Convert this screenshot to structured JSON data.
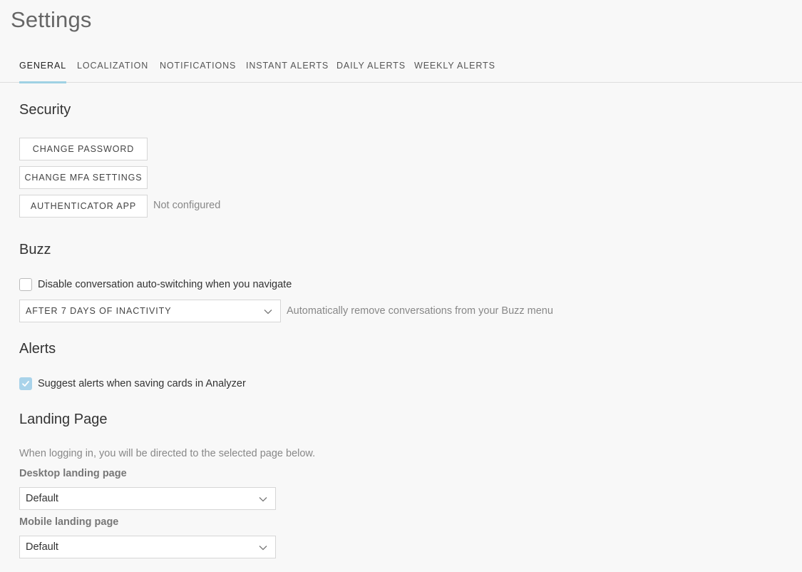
{
  "page": {
    "title": "Settings"
  },
  "tabs": [
    {
      "label": "GENERAL",
      "active": true
    },
    {
      "label": "LOCALIZATION",
      "active": false
    },
    {
      "label": "NOTIFICATIONS",
      "active": false
    },
    {
      "label": "INSTANT ALERTS",
      "active": false
    },
    {
      "label": "DAILY ALERTS",
      "active": false
    },
    {
      "label": "WEEKLY ALERTS",
      "active": false
    }
  ],
  "security": {
    "title": "Security",
    "change_password_label": "CHANGE PASSWORD",
    "change_mfa_label": "CHANGE MFA SETTINGS",
    "authenticator_label": "AUTHENTICATOR APP",
    "authenticator_status": "Not configured"
  },
  "buzz": {
    "title": "Buzz",
    "disable_autoswitch_label": "Disable conversation auto-switching when you navigate",
    "disable_autoswitch_checked": false,
    "removal_select_value": "AFTER 7 DAYS OF INACTIVITY",
    "removal_description": "Automatically remove conversations from your Buzz menu"
  },
  "alerts": {
    "title": "Alerts",
    "suggest_alerts_label": "Suggest alerts when saving cards in Analyzer",
    "suggest_alerts_checked": true
  },
  "landing": {
    "title": "Landing Page",
    "description": "When logging in, you will be directed to the selected page below.",
    "desktop_label": "Desktop landing page",
    "desktop_value": "Default",
    "mobile_label": "Mobile landing page",
    "mobile_value": "Default"
  },
  "colors": {
    "accent": "#9fd2e4",
    "checkbox_checked": "#a9d3ea",
    "background": "#f8f8f8"
  },
  "icons": {
    "checkmark": "check-icon",
    "dropdown": "chevron-down-icon"
  }
}
